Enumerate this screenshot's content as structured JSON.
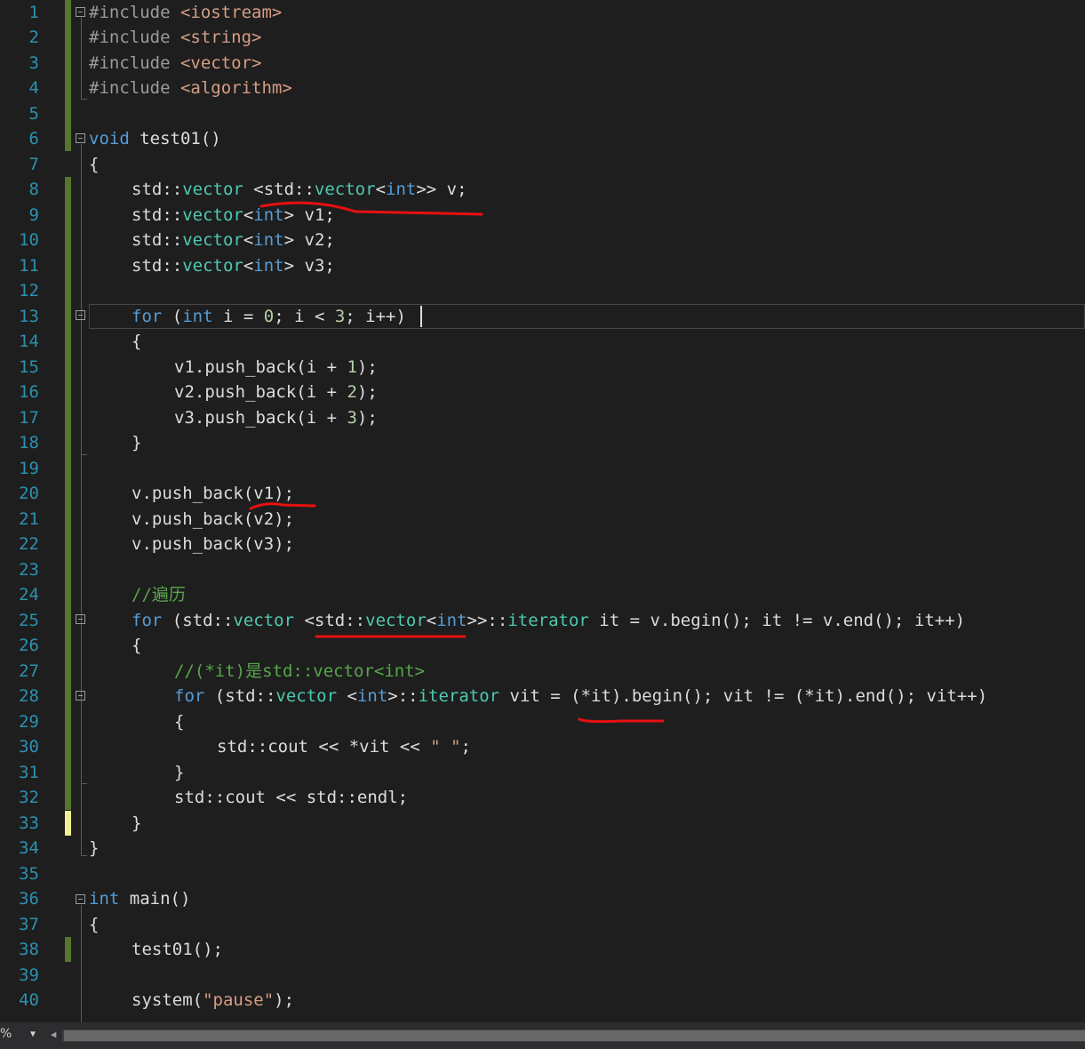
{
  "editor": {
    "line_numbers": [
      "1",
      "2",
      "3",
      "4",
      "5",
      "6",
      "7",
      "8",
      "9",
      "10",
      "11",
      "12",
      "13",
      "14",
      "15",
      "16",
      "17",
      "18",
      "19",
      "20",
      "21",
      "22",
      "23",
      "24",
      "25",
      "26",
      "27",
      "28",
      "29",
      "30",
      "31",
      "32",
      "33",
      "34",
      "35",
      "36",
      "37",
      "38",
      "39",
      "40"
    ],
    "tokens": {
      "l1": [
        "#include",
        "<iostream>"
      ],
      "l2": [
        "#include",
        "<string>"
      ],
      "l3": [
        "#include",
        "<vector>"
      ],
      "l4": [
        "#include",
        "<algorithm>"
      ],
      "l6": [
        "void",
        " test01()"
      ],
      "l7": [
        "{"
      ],
      "l8": [
        "std::",
        "vector",
        " <std::",
        "vector",
        "<",
        "int",
        ">> v;"
      ],
      "l9": [
        "std::",
        "vector",
        "<",
        "int",
        "> v1;"
      ],
      "l10": [
        "std::",
        "vector",
        "<",
        "int",
        "> v2;"
      ],
      "l11": [
        "std::",
        "vector",
        "<",
        "int",
        "> v3;"
      ],
      "l13": [
        "for",
        " (",
        "int",
        " i = ",
        "0",
        "; i < ",
        "3",
        "; i++)"
      ],
      "l14": [
        "{"
      ],
      "l15": [
        "v1.push_back(i + ",
        "1",
        ");"
      ],
      "l16": [
        "v2.push_back(i + ",
        "2",
        ");"
      ],
      "l17": [
        "v3.push_back(i + ",
        "3",
        ");"
      ],
      "l18": [
        "}"
      ],
      "l20": [
        "v.push_back(v1);"
      ],
      "l21": [
        "v.push_back(v2);"
      ],
      "l22": [
        "v.push_back(v3);"
      ],
      "l24": [
        "//遍历"
      ],
      "l25": [
        "for",
        " (std::",
        "vector",
        " <std::",
        "vector",
        "<",
        "int",
        ">>::",
        "iterator",
        " it = v.begin(); it != v.end(); it++)"
      ],
      "l26": [
        "{"
      ],
      "l27": [
        "//(*it)是std::vector<int>"
      ],
      "l28": [
        "for",
        " (std::",
        "vector",
        " <",
        "int",
        ">::",
        "iterator",
        " vit = (*it).begin(); vit != (*it).end(); vit++)"
      ],
      "l29": [
        "{"
      ],
      "l30": [
        "std::cout << *vit << ",
        "\" \"",
        ";"
      ],
      "l31": [
        "}"
      ],
      "l32": [
        "std::cout << std::endl;"
      ],
      "l33": [
        "}"
      ],
      "l34": [
        "}"
      ],
      "l36": [
        "int",
        " main()"
      ],
      "l37": [
        "{"
      ],
      "l38": [
        "test01();"
      ],
      "l40": [
        "system(",
        "\"pause\"",
        ");"
      ]
    }
  },
  "statusbar": {
    "zoom": "%",
    "zoom_dropdown_icon": "caret-down-icon",
    "scroll_left_icon": "arrow-left-icon"
  },
  "colors": {
    "background": "#1e1e1e",
    "line_number": "#2b91af",
    "keyword": "#569cd6",
    "type": "#4ec9b0",
    "string": "#d69d85",
    "comment": "#57a64a",
    "number": "#b5cea8",
    "annotation_underline": "#e81010"
  }
}
